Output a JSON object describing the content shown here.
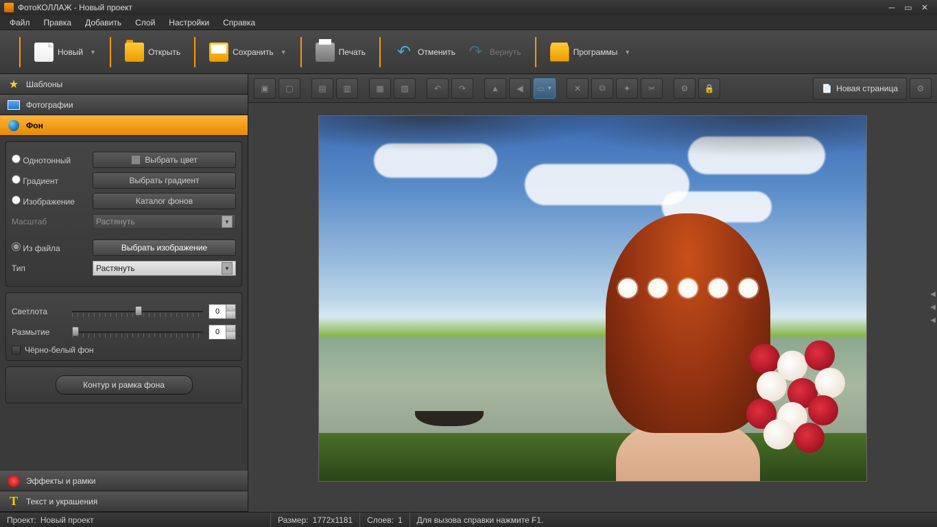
{
  "title": "ФотоКОЛЛАЖ - Новый проект",
  "menu": [
    "Файл",
    "Правка",
    "Добавить",
    "Слой",
    "Настройки",
    "Справка"
  ],
  "toolbar": {
    "new": "Новый",
    "open": "Открыть",
    "save": "Сохранить",
    "print": "Печать",
    "undo": "Отменить",
    "redo": "Вернуть",
    "programs": "Программы"
  },
  "sidebar": {
    "templates": "Шаблоны",
    "photos": "Фотографии",
    "background": "Фон",
    "effects": "Эффекты и рамки",
    "text": "Текст и украшения"
  },
  "bg": {
    "solid": "Однотонный",
    "solid_btn": "Выбрать цвет",
    "gradient": "Градиент",
    "gradient_btn": "Выбрать градиент",
    "image": "Изображение",
    "image_btn": "Каталог фонов",
    "scale_label": "Масштаб",
    "scale_value": "Растянуть",
    "from_file": "Из файла",
    "from_file_btn": "Выбрать изображение",
    "type_label": "Тип",
    "type_value": "Растянуть",
    "brightness": "Светлота",
    "brightness_val": "0",
    "blur": "Размытие",
    "blur_val": "0",
    "bw": "Чёрно-белый фон",
    "contour": "Контур и рамка фона"
  },
  "canvas_toolbar": {
    "new_page": "Новая страница"
  },
  "status": {
    "project_label": "Проект:",
    "project_value": "Новый проект",
    "size_label": "Размер:",
    "size_value": "1772x1181",
    "layers_label": "Слоев:",
    "layers_value": "1",
    "help": "Для вызова справки нажмите F1."
  }
}
